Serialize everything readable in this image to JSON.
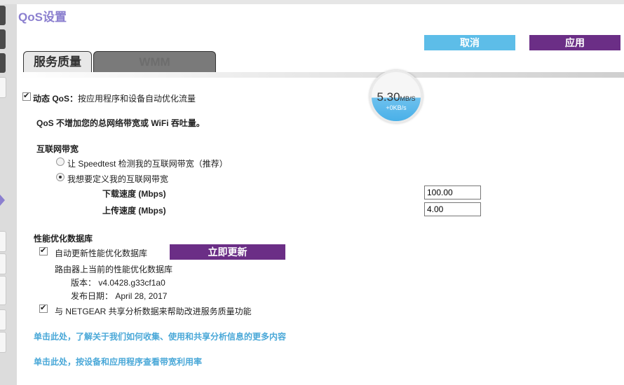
{
  "page": {
    "title": "QoS设置"
  },
  "actions": {
    "cancel_label": "取消",
    "apply_label": "应用"
  },
  "tabs": [
    {
      "label": "服务质量",
      "active": true
    },
    {
      "label": "WMM",
      "active": false
    }
  ],
  "speed_meter": {
    "value": "5.30",
    "unit": "MB/S",
    "sub": "+0KB/s"
  },
  "dynamic_qos": {
    "checked": true,
    "label_bold": "动态 QoS：",
    "label": "按应用程序和设备自动优化流量",
    "note": "QoS 不增加您的总网络带宽或 WiFi 吞吐量。"
  },
  "bandwidth": {
    "heading": "互联网带宽",
    "option_speedtest": "让 Speedtest 检测我的互联网带宽（推荐）",
    "option_custom": "我想要定义我的互联网带宽",
    "selected": "custom",
    "download_label": "下载速度 (Mbps)",
    "download_value": "100.00",
    "upload_label": "上传速度 (Mbps)",
    "upload_value": "4.00"
  },
  "database": {
    "heading": "性能优化数据库",
    "auto_update_checked": true,
    "auto_update_label": "自动更新性能优化数据库",
    "update_now_label": "立即更新",
    "current_label": "路由器上当前的性能优化数据库",
    "version_label": "版本：",
    "version_value": "v4.0428.g33cf1a0",
    "release_label": "发布日期：",
    "release_value": "April 28, 2017",
    "share_checked": true,
    "share_label": "与 NETGEAR 共享分析数据来帮助改进服务质量功能"
  },
  "links": {
    "learn_more": "单击此处，了解关于我们如何收集、使用和共享分析信息的更多内容",
    "view_usage": "单击此处，按设备和应用程序查看带宽利用率"
  },
  "colors": {
    "accent_purple": "#6b2e86",
    "accent_blue": "#5dbde8",
    "title_lavender": "#8b7fcf",
    "link_blue": "#4aa8d8"
  }
}
